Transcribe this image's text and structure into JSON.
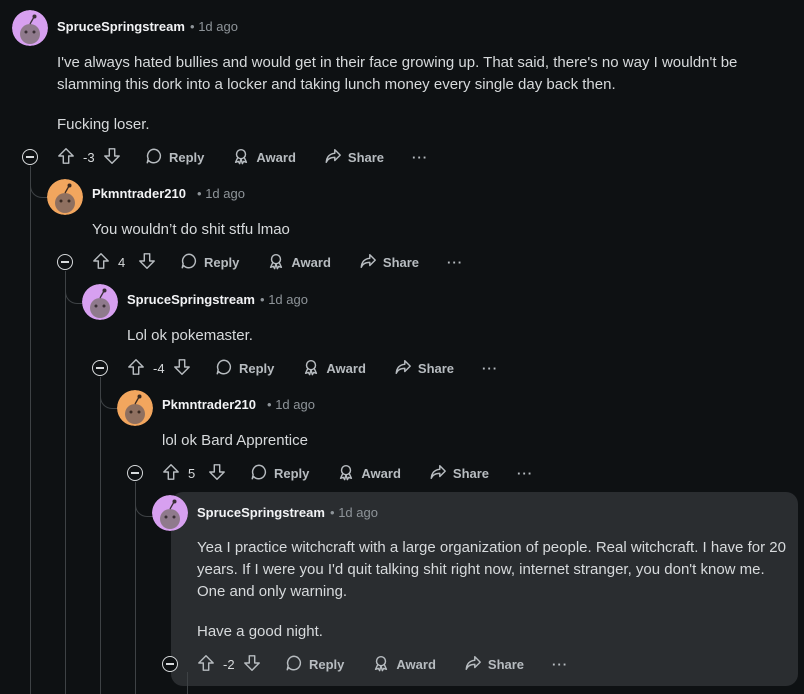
{
  "comments": [
    {
      "author": "SpruceSpringstream",
      "time": "1d ago",
      "paragraphs": [
        "I've always hated bullies and would get in their face growing up. That said, there's no way I wouldn't be slamming this dork into a locker and taking lunch money every single day back then.",
        "Fucking loser."
      ],
      "score": "-3",
      "avatar_color": "#d7a0f0"
    },
    {
      "author": "Pkmntrader210",
      "time": "1d ago",
      "paragraphs": [
        "You wouldn’t do shit stfu lmao"
      ],
      "score": "4",
      "avatar_color": "#f2a65e"
    },
    {
      "author": "SpruceSpringstream",
      "time": "1d ago",
      "paragraphs": [
        "Lol ok pokemaster."
      ],
      "score": "-4",
      "avatar_color": "#d7a0f0"
    },
    {
      "author": "Pkmntrader210",
      "time": "1d ago",
      "paragraphs": [
        "lol ok Bard Apprentice"
      ],
      "score": "5",
      "avatar_color": "#f2a65e"
    },
    {
      "author": "SpruceSpringstream",
      "time": "1d ago",
      "paragraphs": [
        "Yea I practice witchcraft with a large organization of people. Real witchcraft. I have for 20 years. If I were you I'd quit talking shit right now, internet stranger, you don't know me. One and only warning.",
        "Have a good night."
      ],
      "score": "-2",
      "avatar_color": "#d7a0f0"
    }
  ],
  "actions": {
    "reply": "Reply",
    "award": "Award",
    "share": "Share",
    "more": "···",
    "dot": "•"
  },
  "colors": {
    "background": "#0e1113",
    "highlight": "#2a2d30",
    "text": "#d7dadc",
    "muted": "#8e9499"
  },
  "icons": [
    "collapse-icon",
    "upvote-icon",
    "downvote-icon",
    "comment-icon",
    "award-icon",
    "share-icon",
    "more-icon"
  ]
}
